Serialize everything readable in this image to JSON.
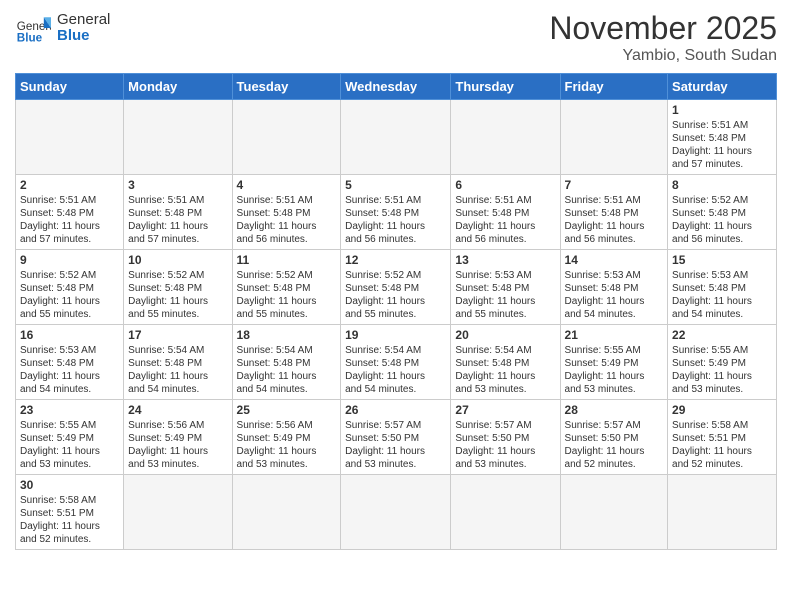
{
  "header": {
    "logo_general": "General",
    "logo_blue": "Blue",
    "month_title": "November 2025",
    "location": "Yambio, South Sudan"
  },
  "weekdays": [
    "Sunday",
    "Monday",
    "Tuesday",
    "Wednesday",
    "Thursday",
    "Friday",
    "Saturday"
  ],
  "weeks": [
    {
      "days": [
        {
          "num": "",
          "info": "",
          "empty": true
        },
        {
          "num": "",
          "info": "",
          "empty": true
        },
        {
          "num": "",
          "info": "",
          "empty": true
        },
        {
          "num": "",
          "info": "",
          "empty": true
        },
        {
          "num": "",
          "info": "",
          "empty": true
        },
        {
          "num": "",
          "info": "",
          "empty": true
        },
        {
          "num": "1",
          "info": "Sunrise: 5:51 AM\nSunset: 5:48 PM\nDaylight: 11 hours\nand 57 minutes.",
          "empty": false
        }
      ]
    },
    {
      "days": [
        {
          "num": "2",
          "info": "Sunrise: 5:51 AM\nSunset: 5:48 PM\nDaylight: 11 hours\nand 57 minutes.",
          "empty": false
        },
        {
          "num": "3",
          "info": "Sunrise: 5:51 AM\nSunset: 5:48 PM\nDaylight: 11 hours\nand 57 minutes.",
          "empty": false
        },
        {
          "num": "4",
          "info": "Sunrise: 5:51 AM\nSunset: 5:48 PM\nDaylight: 11 hours\nand 56 minutes.",
          "empty": false
        },
        {
          "num": "5",
          "info": "Sunrise: 5:51 AM\nSunset: 5:48 PM\nDaylight: 11 hours\nand 56 minutes.",
          "empty": false
        },
        {
          "num": "6",
          "info": "Sunrise: 5:51 AM\nSunset: 5:48 PM\nDaylight: 11 hours\nand 56 minutes.",
          "empty": false
        },
        {
          "num": "7",
          "info": "Sunrise: 5:51 AM\nSunset: 5:48 PM\nDaylight: 11 hours\nand 56 minutes.",
          "empty": false
        },
        {
          "num": "8",
          "info": "Sunrise: 5:52 AM\nSunset: 5:48 PM\nDaylight: 11 hours\nand 56 minutes.",
          "empty": false
        }
      ]
    },
    {
      "days": [
        {
          "num": "9",
          "info": "Sunrise: 5:52 AM\nSunset: 5:48 PM\nDaylight: 11 hours\nand 55 minutes.",
          "empty": false
        },
        {
          "num": "10",
          "info": "Sunrise: 5:52 AM\nSunset: 5:48 PM\nDaylight: 11 hours\nand 55 minutes.",
          "empty": false
        },
        {
          "num": "11",
          "info": "Sunrise: 5:52 AM\nSunset: 5:48 PM\nDaylight: 11 hours\nand 55 minutes.",
          "empty": false
        },
        {
          "num": "12",
          "info": "Sunrise: 5:52 AM\nSunset: 5:48 PM\nDaylight: 11 hours\nand 55 minutes.",
          "empty": false
        },
        {
          "num": "13",
          "info": "Sunrise: 5:53 AM\nSunset: 5:48 PM\nDaylight: 11 hours\nand 55 minutes.",
          "empty": false
        },
        {
          "num": "14",
          "info": "Sunrise: 5:53 AM\nSunset: 5:48 PM\nDaylight: 11 hours\nand 54 minutes.",
          "empty": false
        },
        {
          "num": "15",
          "info": "Sunrise: 5:53 AM\nSunset: 5:48 PM\nDaylight: 11 hours\nand 54 minutes.",
          "empty": false
        }
      ]
    },
    {
      "days": [
        {
          "num": "16",
          "info": "Sunrise: 5:53 AM\nSunset: 5:48 PM\nDaylight: 11 hours\nand 54 minutes.",
          "empty": false
        },
        {
          "num": "17",
          "info": "Sunrise: 5:54 AM\nSunset: 5:48 PM\nDaylight: 11 hours\nand 54 minutes.",
          "empty": false
        },
        {
          "num": "18",
          "info": "Sunrise: 5:54 AM\nSunset: 5:48 PM\nDaylight: 11 hours\nand 54 minutes.",
          "empty": false
        },
        {
          "num": "19",
          "info": "Sunrise: 5:54 AM\nSunset: 5:48 PM\nDaylight: 11 hours\nand 54 minutes.",
          "empty": false
        },
        {
          "num": "20",
          "info": "Sunrise: 5:54 AM\nSunset: 5:48 PM\nDaylight: 11 hours\nand 53 minutes.",
          "empty": false
        },
        {
          "num": "21",
          "info": "Sunrise: 5:55 AM\nSunset: 5:49 PM\nDaylight: 11 hours\nand 53 minutes.",
          "empty": false
        },
        {
          "num": "22",
          "info": "Sunrise: 5:55 AM\nSunset: 5:49 PM\nDaylight: 11 hours\nand 53 minutes.",
          "empty": false
        }
      ]
    },
    {
      "days": [
        {
          "num": "23",
          "info": "Sunrise: 5:55 AM\nSunset: 5:49 PM\nDaylight: 11 hours\nand 53 minutes.",
          "empty": false
        },
        {
          "num": "24",
          "info": "Sunrise: 5:56 AM\nSunset: 5:49 PM\nDaylight: 11 hours\nand 53 minutes.",
          "empty": false
        },
        {
          "num": "25",
          "info": "Sunrise: 5:56 AM\nSunset: 5:49 PM\nDaylight: 11 hours\nand 53 minutes.",
          "empty": false
        },
        {
          "num": "26",
          "info": "Sunrise: 5:57 AM\nSunset: 5:50 PM\nDaylight: 11 hours\nand 53 minutes.",
          "empty": false
        },
        {
          "num": "27",
          "info": "Sunrise: 5:57 AM\nSunset: 5:50 PM\nDaylight: 11 hours\nand 53 minutes.",
          "empty": false
        },
        {
          "num": "28",
          "info": "Sunrise: 5:57 AM\nSunset: 5:50 PM\nDaylight: 11 hours\nand 52 minutes.",
          "empty": false
        },
        {
          "num": "29",
          "info": "Sunrise: 5:58 AM\nSunset: 5:51 PM\nDaylight: 11 hours\nand 52 minutes.",
          "empty": false
        }
      ]
    },
    {
      "days": [
        {
          "num": "30",
          "info": "Sunrise: 5:58 AM\nSunset: 5:51 PM\nDaylight: 11 hours\nand 52 minutes.",
          "empty": false
        },
        {
          "num": "",
          "info": "",
          "empty": true
        },
        {
          "num": "",
          "info": "",
          "empty": true
        },
        {
          "num": "",
          "info": "",
          "empty": true
        },
        {
          "num": "",
          "info": "",
          "empty": true
        },
        {
          "num": "",
          "info": "",
          "empty": true
        },
        {
          "num": "",
          "info": "",
          "empty": true
        }
      ]
    }
  ]
}
